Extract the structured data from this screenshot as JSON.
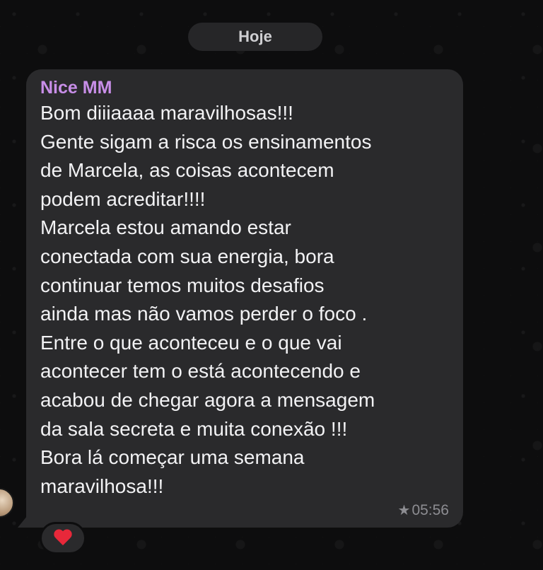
{
  "date_separator": "Hoje",
  "message": {
    "sender": "Nice MM",
    "lines": [
      "Bom diiiaaaa maravilhosas!!!",
      "Gente sigam a risca os ensinamentos",
      "de Marcela, as coisas acontecem",
      "podem acreditar!!!!",
      "Marcela estou amando estar",
      "conectada com sua energia, bora",
      "continuar temos muitos desafios",
      "ainda mas não vamos perder o foco .",
      "Entre o que aconteceu e o que vai",
      "acontecer tem o está acontecendo e",
      "acabou de chegar agora a mensagem",
      "da sala secreta e muita conexão !!!",
      "Bora lá começar uma semana",
      "maravilhosa!!!"
    ],
    "time": "05:56",
    "starred_icon": "star-icon",
    "reaction": "heart-icon"
  },
  "colors": {
    "background": "#0d0d0e",
    "bubble": "#2a2a2c",
    "sender_name": "#c88ee8",
    "text": "#f2f2f4",
    "reaction_heart": "#e8283a"
  }
}
